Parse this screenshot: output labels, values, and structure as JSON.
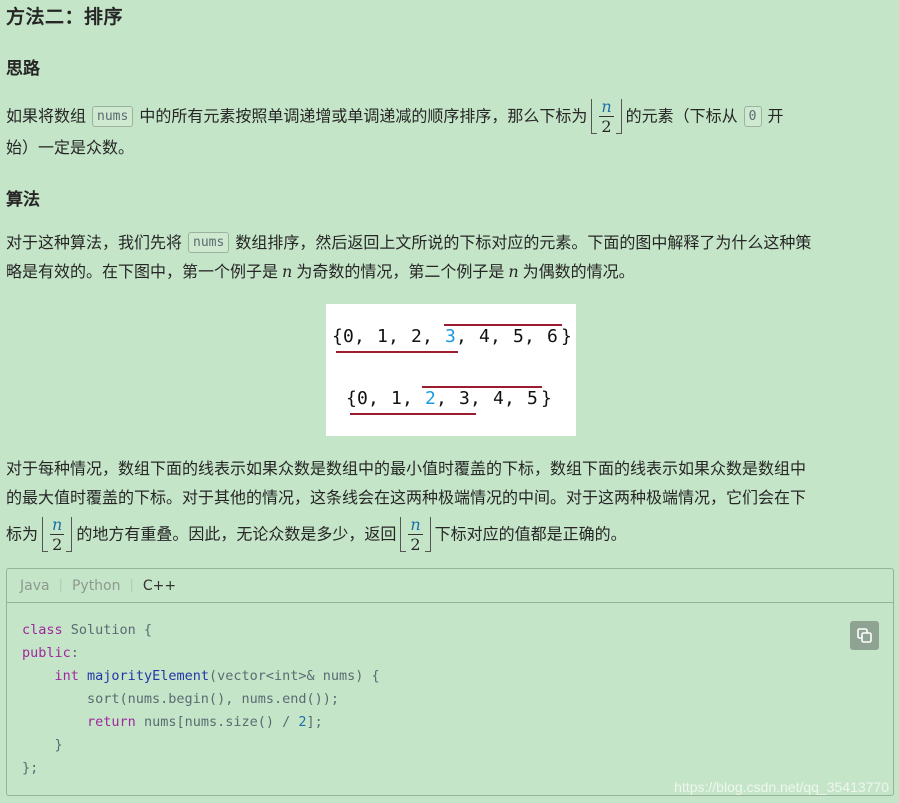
{
  "title": "方法二：排序",
  "section_idea": {
    "heading": "思路",
    "line1_a": "如果将数组",
    "code_nums": "nums",
    "line1_b": "中的所有元素按照单调递增或单调递减的顺序排序，那么下标为",
    "frac_num": "n",
    "frac_den": "2",
    "line1_c": "的元素（下标从",
    "code_zero": "0",
    "line1_d": "开",
    "line2": "始）一定是众数。"
  },
  "section_algo": {
    "heading": "算法",
    "line1_a": "对于这种算法，我们先将",
    "code_nums": "nums",
    "line1_b": "数组排序，然后返回上文所说的下标对应的元素。下面的图中解释了为什么这种策",
    "line2_a": "略是有效的。在下图中，第一个例子是",
    "var_n1": "n",
    "line2_b": "为奇数的情况，第二个例子是",
    "var_n2": "n",
    "line2_c": "为偶数的情况。"
  },
  "figure": {
    "row1": {
      "open": "{",
      "items": [
        "0",
        "1",
        "2",
        "3",
        "4",
        "5",
        "6"
      ],
      "close": "}",
      "highlight_index": 3
    },
    "row2": {
      "open": "{",
      "items": [
        "0",
        "1",
        "2",
        "3",
        "4",
        "5"
      ],
      "close": "}",
      "highlight_index": 2
    },
    "colors": {
      "text": "#111111",
      "highlight": "#1a9be0",
      "line": "#9b1c2e"
    }
  },
  "section_explain": {
    "line1": "对于每种情况，数组下面的线表示如果众数是数组中的最小值时覆盖的下标，数组下面的线表示如果众数是数组中",
    "line2": "的最大值时覆盖的下标。对于其他的情况，这条线会在这两种极端情况的中间。对于这两种极端情况，它们会在下",
    "line3_a": "标为",
    "frac1_num": "n",
    "frac1_den": "2",
    "line3_b": "的地方有重叠。因此，无论众数是多少，返回",
    "frac2_num": "n",
    "frac2_den": "2",
    "line3_c": "下标对应的值都是正确的。"
  },
  "code_tabs": [
    "Java",
    "Python",
    "C++"
  ],
  "active_tab": "C++",
  "code": {
    "l1_kw": "class",
    "l1_rest": " Solution {",
    "l2_kw": "public",
    "l2_rest": ":",
    "l3_indent": "    ",
    "l3_type": "int",
    "l3_fn": "majorityElement",
    "l3_rest": "(vector<int>& nums) {",
    "l4": "        sort(nums.begin(), nums.end());",
    "l5_indent": "        ",
    "l5_kw": "return",
    "l5_a": " nums[nums.size() / ",
    "l5_num": "2",
    "l5_b": "];",
    "l6": "    }",
    "l7": "};"
  },
  "watermark": "https://blog.csdn.net/qq_35413770"
}
